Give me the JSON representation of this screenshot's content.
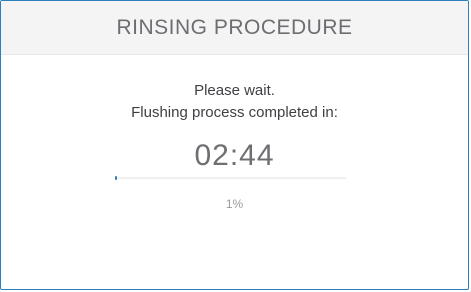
{
  "dialog": {
    "title": "RINSING PROCEDURE",
    "message_line1": "Please wait.",
    "message_line2": "Flushing process completed in:",
    "timer": "02:44",
    "progress": {
      "fraction": 0.01,
      "label": "1%"
    }
  },
  "colors": {
    "accent": "#2a7fbf",
    "header_bg": "#f4f4f5",
    "title_text": "#6d6e72",
    "body_text": "#3f4044"
  }
}
